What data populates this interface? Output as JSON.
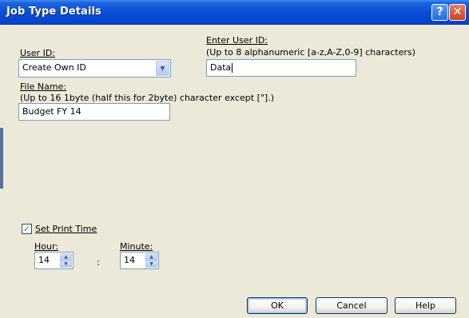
{
  "window": {
    "title": "Job Type Details",
    "help_glyph": "?",
    "close_glyph": "✕"
  },
  "user_id": {
    "label": "User ID:",
    "selected": "Create Own ID"
  },
  "enter_user_id": {
    "label": "Enter User ID:",
    "hint": "(Up to 8 alphanumeric [a-z,A-Z,0-9] characters)",
    "value": "Data"
  },
  "file_name": {
    "label": "File Name:",
    "hint": "(Up to 16 1byte (half this for 2byte) character except [\"].)",
    "value": "Budget FY 14"
  },
  "print_time": {
    "checkbox_label": "Set Print Time",
    "checked": true,
    "hour_label": "Hour:",
    "hour_value": "14",
    "minute_label": "Minute:",
    "minute_value": "14",
    "separator": ":"
  },
  "buttons": {
    "ok": "OK",
    "cancel": "Cancel",
    "help": "Help"
  },
  "icons": {
    "combo_arrow": "chevron-down-icon",
    "spin_up": "spin-up-icon",
    "spin_down": "spin-down-icon",
    "check": "checkmark-icon"
  }
}
